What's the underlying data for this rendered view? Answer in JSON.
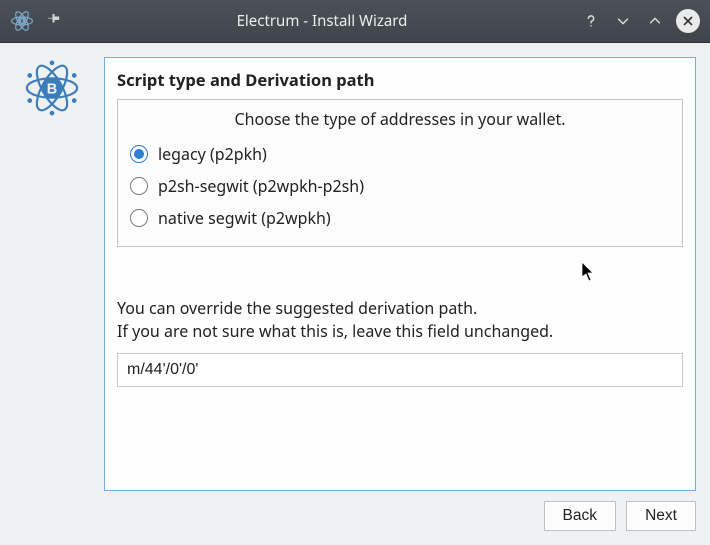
{
  "window": {
    "title": "Electrum  -  Install Wizard"
  },
  "panel": {
    "heading": "Script type and Derivation path",
    "group_label": "Choose the type of addresses in your wallet.",
    "options": [
      {
        "label": "legacy (p2pkh)",
        "checked": true
      },
      {
        "label": "p2sh-segwit (p2wpkh-p2sh)",
        "checked": false
      },
      {
        "label": "native segwit (p2wpkh)",
        "checked": false
      }
    ],
    "hint_line1": "You can override the suggested derivation path.",
    "hint_line2": "If you are not sure what this is, leave this field unchanged.",
    "derivation_path": "m/44'/0'/0'"
  },
  "buttons": {
    "back": "Back",
    "next": "Next"
  }
}
